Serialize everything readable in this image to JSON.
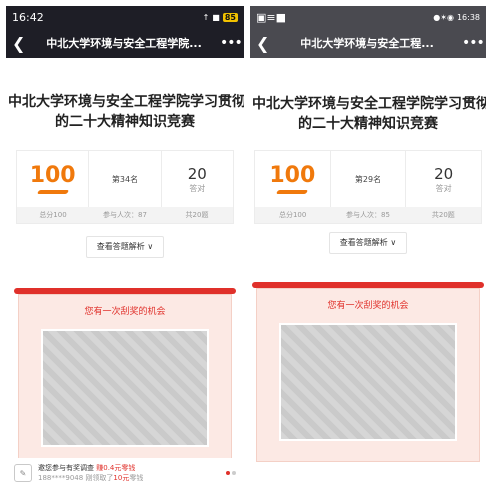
{
  "left": {
    "status": {
      "time": "16:42",
      "signal": "↑",
      "wifi": "■",
      "battery": "85"
    },
    "window_title": "中北大学环境与安全工程学院...",
    "heading_line1": "中北大学环境与安全工程学院学习贯彻党",
    "heading_line2": "的二十大精神知识竞赛",
    "score": "100",
    "rank": "第34名",
    "correct_count": "20",
    "correct_label": "答对",
    "total_label": "总分100",
    "participants": "参与人次：87",
    "question_total": "共20题",
    "analysis_label": "查看答题解析",
    "chance_text": "您有一次刮奖的机会",
    "survey": {
      "line1_prefix": "邀您参与有奖调查",
      "line1_red": "赚0.4元零钱",
      "line2_prefix": "188****9048 刚领取了",
      "line2_red": "10元",
      "line2_suffix": "零钱"
    }
  },
  "right": {
    "status": {
      "icons": "▣≡■",
      "right_icons": "●✶◉",
      "time": "16:38"
    },
    "window_title": "中北大学环境与安全工程...",
    "heading_line1": "中北大学环境与安全工程学院学习贯彻党",
    "heading_line2": "的二十大精神知识竞赛",
    "score": "100",
    "rank": "第29名",
    "correct_count": "20",
    "correct_label": "答对",
    "total_label": "总分100",
    "participants": "参与人次：85",
    "question_total": "共20题",
    "analysis_label": "查看答题解析",
    "chance_text": "您有一次刮奖的机会"
  },
  "colors": {
    "accent_orange": "#f0790c",
    "accent_red": "#e0302a",
    "card_pink": "#fce9e4"
  }
}
